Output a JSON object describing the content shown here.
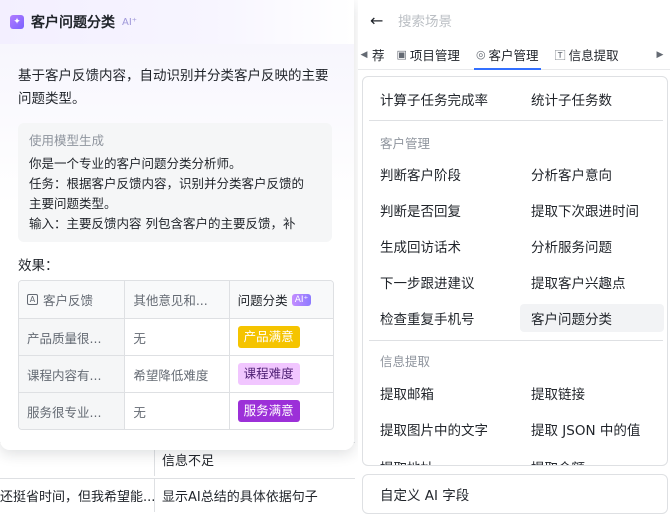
{
  "background_table": {
    "row1": {
      "col1": "",
      "col2": "信息不足"
    },
    "row2": {
      "col1": "还挺省时间，但我希望能...",
      "col2": "显示AI总结的具体依据句子"
    }
  },
  "card": {
    "title": "客户问题分类",
    "ai_tag": "AI⁺",
    "description": "基于客户反馈内容，自动识别并分类客户反映的主要问题类型。",
    "prompt_label": "使用模型生成",
    "prompt_lines": [
      "你是一个专业的客户问题分类分析师。",
      "任务：根据客户反馈内容，识别并分类客户反馈的",
      "主要问题类型。",
      "输入：主要反馈内容 列包含客户的主要反馈，补"
    ],
    "effect_label": "效果：",
    "table": {
      "headers": [
        "客户反馈",
        "其他意见和...",
        "问题分类"
      ],
      "header_ai_badge": "AI⁺",
      "rows": [
        {
          "feedback": "产品质量很...",
          "other": "无",
          "category": "产品满意",
          "tag_bg": "#f5c400",
          "tag_color": "#ffffff"
        },
        {
          "feedback": "课程内容有...",
          "other": "希望降低难度",
          "category": "课程难度",
          "tag_bg": "#f1c6ff",
          "tag_color": "#4d1e73"
        },
        {
          "feedback": "服务很专业...",
          "other": "无",
          "category": "服务满意",
          "tag_bg": "#9c30d8",
          "tag_color": "#ffffff"
        }
      ]
    }
  },
  "panel": {
    "search_placeholder": "搜索场景",
    "tabs": [
      {
        "label": "荐",
        "icon": ""
      },
      {
        "label": "项目管理",
        "icon": "▣"
      },
      {
        "label": "客户管理",
        "icon": "◎"
      },
      {
        "label": "信息提取",
        "icon": "🅃"
      }
    ],
    "top_items": [
      "计算子任务完成率",
      "统计子任务数"
    ],
    "sections": [
      {
        "title": "客户管理",
        "items": [
          [
            "判断客户阶段",
            "分析客户意向"
          ],
          [
            "判断是否回复",
            "提取下次跟进时间"
          ],
          [
            "生成回访话术",
            "分析服务问题"
          ],
          [
            "下一步跟进建议",
            "提取客户兴趣点"
          ],
          [
            "检查重复手机号",
            "客户问题分类"
          ]
        ]
      },
      {
        "title": "信息提取",
        "items": [
          [
            "提取邮箱",
            "提取链接"
          ],
          [
            "提取图片中的文字",
            "提取 JSON 中的值"
          ],
          [
            "提取地址",
            "提取金额"
          ]
        ]
      }
    ],
    "custom_field": "自定义 AI 字段"
  }
}
